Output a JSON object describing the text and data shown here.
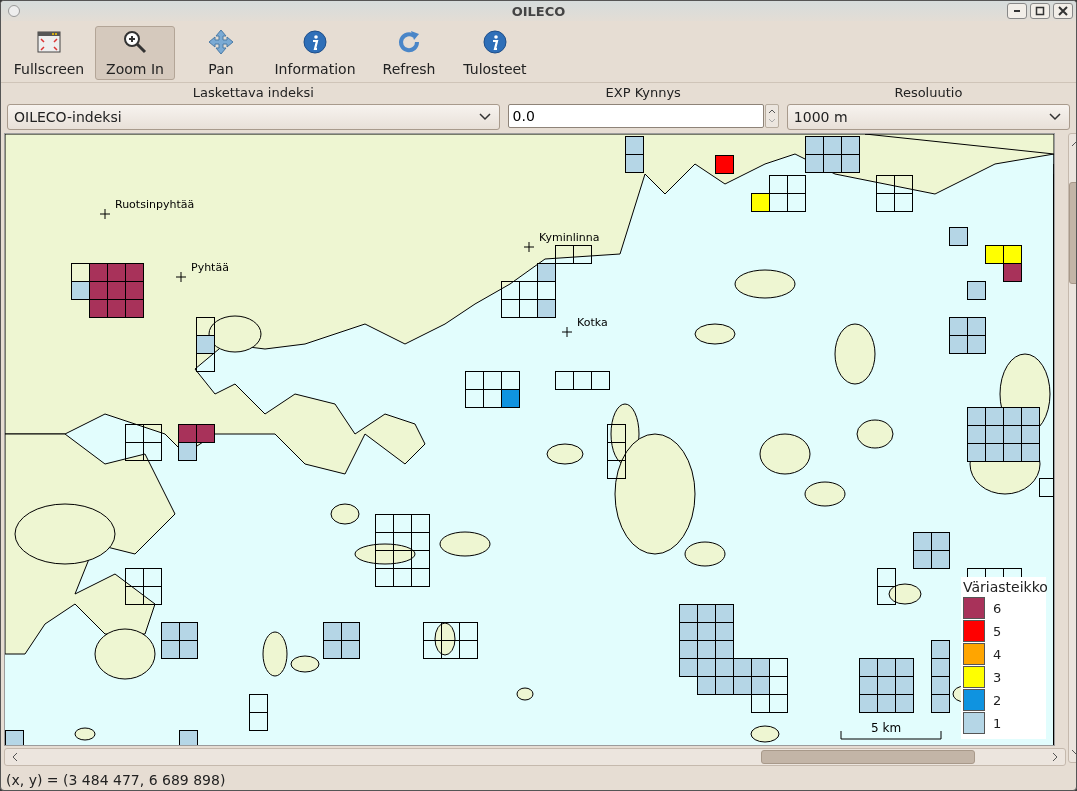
{
  "window": {
    "title": "OILECO"
  },
  "toolbar": [
    {
      "label": "Fullscreen",
      "kind": "fullscreen",
      "selected": false
    },
    {
      "label": "Zoom In",
      "kind": "zoom",
      "selected": true
    },
    {
      "label": "Pan",
      "kind": "pan",
      "selected": false
    },
    {
      "label": "Information",
      "kind": "info",
      "selected": false
    },
    {
      "label": "Refresh",
      "kind": "refresh",
      "selected": false
    },
    {
      "label": "Tulosteet",
      "kind": "info",
      "selected": false
    }
  ],
  "controls": {
    "index": {
      "label": "Laskettava indeksi",
      "value": "OILECO-indeksi"
    },
    "threshold": {
      "label": "EXP Kynnys",
      "value": "0.0"
    },
    "resolution": {
      "label": "Resoluutio",
      "value": "1000 m"
    }
  },
  "map": {
    "places": [
      {
        "name": "Ruotsinpyhtää"
      },
      {
        "name": "Pyhtää"
      },
      {
        "name": "Kyminlinna"
      },
      {
        "name": "Kotka"
      }
    ],
    "scale": "5 km",
    "legend": {
      "title": "Väriasteikko",
      "items": [
        {
          "label": "6",
          "color": "#a8325a"
        },
        {
          "label": "5",
          "color": "#ff0000"
        },
        {
          "label": "4",
          "color": "#ffa500"
        },
        {
          "label": "3",
          "color": "#ffff00"
        },
        {
          "label": "2",
          "color": "#0f93e0"
        },
        {
          "label": "1",
          "color": "#b5d6e6"
        }
      ]
    }
  },
  "status_bar": "(x, y) = (3 484 477, 6 689 898)"
}
